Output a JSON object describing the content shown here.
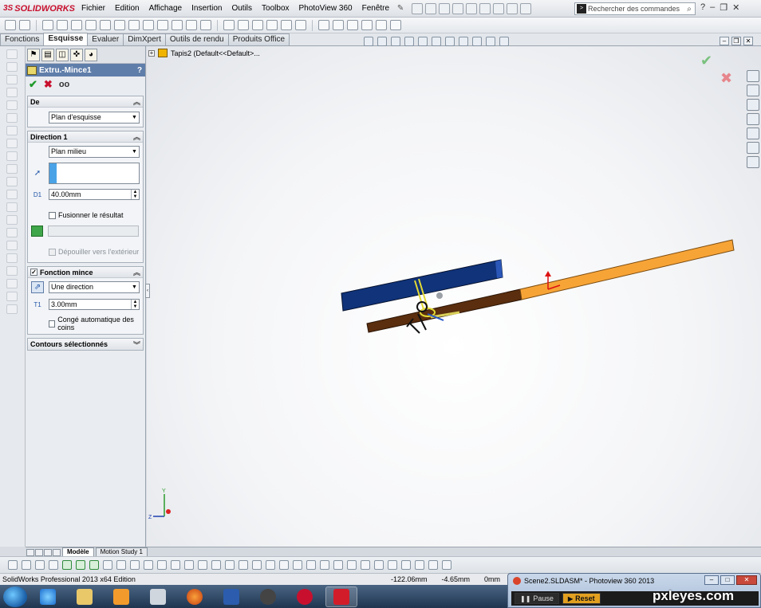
{
  "app": {
    "logo": "SOLIDWORKS",
    "menus": [
      "Fichier",
      "Edition",
      "Affichage",
      "Insertion",
      "Outils",
      "Toolbox",
      "PhotoView 360",
      "Fenêtre"
    ],
    "search_placeholder": "Rechercher des commandes"
  },
  "command_tabs": [
    {
      "label": "Fonctions",
      "active": false
    },
    {
      "label": "Esquisse",
      "active": true
    },
    {
      "label": "Evaluer",
      "active": false
    },
    {
      "label": "DimXpert",
      "active": false
    },
    {
      "label": "Outils de rendu",
      "active": false
    },
    {
      "label": "Produits Office",
      "active": false
    }
  ],
  "property_manager": {
    "title": "Extru.-Mince1",
    "help": "?",
    "de": {
      "header": "De",
      "selected": "Plan d'esquisse"
    },
    "direction1": {
      "header": "Direction 1",
      "selected": "Plan milieu",
      "depth": "40.00mm",
      "depth_icon_label": "D1",
      "merge_label": "Fusionner le résultat",
      "draft_label": "Dépouiller vers l'extérieur"
    },
    "thin": {
      "header": "Fonction mince",
      "selected": "Une direction",
      "thickness": "3.00mm",
      "thickness_icon_label": "T1",
      "fillet_label": "Congé automatique des coins"
    },
    "contours": {
      "header": "Contours sélectionnés"
    }
  },
  "tree": {
    "root": "Tapis2  (Default<<Default>..."
  },
  "model_tabs": [
    {
      "label": "Modèle",
      "active": true
    },
    {
      "label": "Motion Study 1",
      "active": false
    }
  ],
  "status": {
    "edition": "SolidWorks Professional 2013 x64 Edition",
    "x": "-122.06mm",
    "y": "-4.65mm",
    "z": "0mm"
  },
  "photoview": {
    "title": "Scene2.SLDASM* - Photoview 360 2013",
    "pause": "Pause",
    "reset": "Reset"
  },
  "triad": {
    "y": "Y",
    "z": "Z"
  },
  "watermark": "pxleyes.com",
  "colors": {
    "pm_title": "#5f7eaa",
    "navy_bar": "#10337a",
    "brown_bar": "#5a2e0e",
    "orange_bar": "#f7a437"
  }
}
